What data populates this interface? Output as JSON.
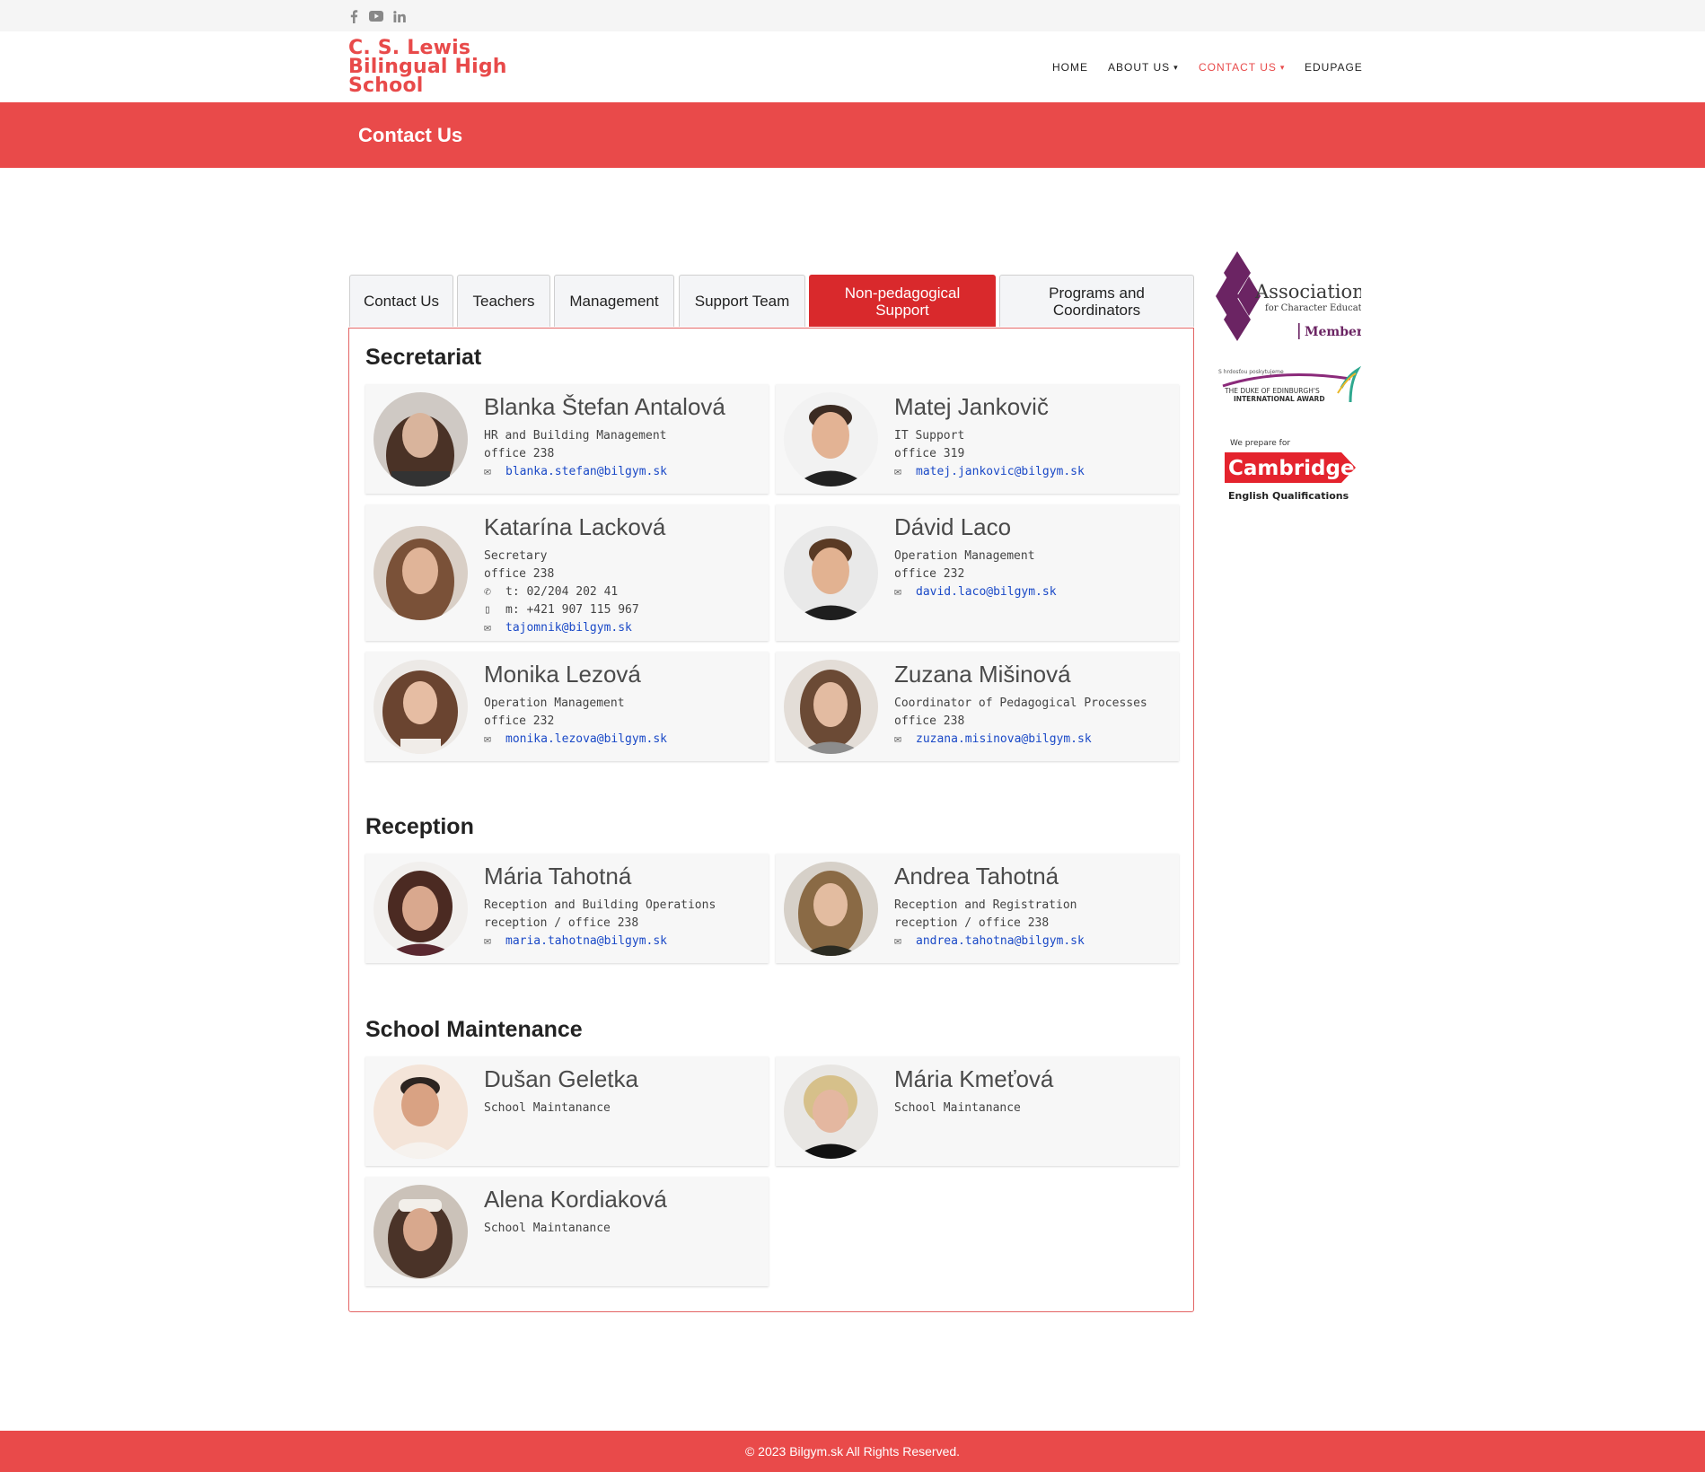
{
  "topbar": {
    "social": [
      {
        "name": "facebook-icon",
        "glyph": "f"
      },
      {
        "name": "youtube-icon",
        "glyph": "▶"
      },
      {
        "name": "linkedin-icon",
        "glyph": "in"
      }
    ]
  },
  "header": {
    "logo_line1": "C. S. Lewis",
    "logo_line2": "Bilingual High",
    "logo_line3": "School",
    "nav": {
      "home": "HOME",
      "about": "ABOUT US",
      "contact": "CONTACT US",
      "edupage": "EDUPAGE"
    }
  },
  "banner": {
    "title": "Contact Us"
  },
  "tabs": {
    "contact": "Contact Us",
    "teachers": "Teachers",
    "management": "Management",
    "support": "Support Team",
    "nonped_1": "Non-pedagogical",
    "nonped_2": "Support",
    "programs_1": "Programs and",
    "programs_2": "Coordinators"
  },
  "sections": {
    "secretariat": "Secretariat",
    "reception": "Reception",
    "maintenance": "School Maintenance"
  },
  "people": {
    "antalova": {
      "name": "Blanka Štefan Antalová",
      "role": "HR and Building Management",
      "office": "office 238",
      "email": "blanka.stefan@bilgym.sk"
    },
    "jankovic": {
      "name": "Matej Jankovič",
      "role": "IT Support",
      "office": "office 319",
      "email": "matej.jankovic@bilgym.sk"
    },
    "lackova": {
      "name": "Katarína Lacková",
      "role": "Secretary",
      "office": "office 238",
      "phone": "t: 02/204 202 41",
      "mobile": "m: +421 907 115 967",
      "email": "tajomnik@bilgym.sk"
    },
    "laco": {
      "name": "Dávid Laco",
      "role": "Operation Management",
      "office": "office 232",
      "email": "david.laco@bilgym.sk"
    },
    "lezova": {
      "name": "Monika Lezová",
      "role": "Operation Management",
      "office": "office 232",
      "email": "monika.lezova@bilgym.sk"
    },
    "misinova": {
      "name": "Zuzana Mišinová",
      "role": "Coordinator of Pedagogical Processes",
      "office": "office 238",
      "email": "zuzana.misinova@bilgym.sk"
    },
    "m_tahotna": {
      "name": "Mária Tahotná",
      "role": "Reception and Building Operations",
      "office": "reception / office 238",
      "email": "maria.tahotna@bilgym.sk"
    },
    "a_tahotna": {
      "name": "Andrea Tahotná",
      "role": "Reception and Registration",
      "office": "reception / office 238",
      "email": "andrea.tahotna@bilgym.sk"
    },
    "geletka": {
      "name": "Dušan Geletka",
      "role": "School Maintanance"
    },
    "kmetova": {
      "name": "Mária Kmeťová",
      "role": "School Maintanance"
    },
    "kordiakova": {
      "name": "Alena Kordiaková",
      "role": "School Maintanance"
    }
  },
  "sidebar": {
    "ace_title": "Association",
    "ace_sub": "for Character Education",
    "ace_member": "Member",
    "doe_small": "S hrdosťou poskytujeme",
    "doe_line1": "THE DUKE OF EDINBURGH'S",
    "doe_line2": "INTERNATIONAL AWARD",
    "cam_small": "We prepare for",
    "cam_brand": "Cambridge",
    "cam_sub": "English Qualifications"
  },
  "footer": {
    "text": "© 2023 Bilgym.sk All Rights Reserved."
  },
  "colors": {
    "brand_red": "#e94a4a",
    "active_tab": "#d9292c",
    "link_blue": "#1a49c7",
    "ace_purple": "#6b2463"
  }
}
